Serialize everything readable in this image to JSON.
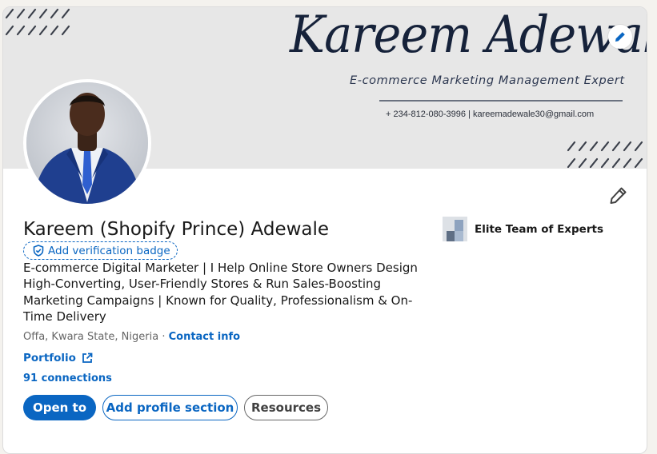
{
  "banner": {
    "name": "Kareem Adewale",
    "subtitle": "E-commerce Marketing Management Expert",
    "contact": "+ 234-812-080-3996  |  kareemadewale30@gmail.com"
  },
  "profile": {
    "name": "Kareem (Shopify Prince) Adewale",
    "verification_label": "Add verification badge",
    "headline": "E-commerce Digital Marketer | I Help Online Store Owners Design High-Converting, User-Friendly Stores & Run Sales-Boosting Marketing Campaigns | Known for Quality, Professionalism & On-Time Delivery",
    "location": "Offa, Kwara State, Nigeria",
    "separator": "·",
    "contact_info": "Contact info",
    "portfolio": "Portfolio",
    "connections": "91 connections"
  },
  "company": {
    "name": "Elite Team of Experts"
  },
  "actions": {
    "open_to": "Open to",
    "add_section": "Add profile section",
    "resources": "Resources"
  },
  "icons": {
    "edit_banner": "pencil-icon",
    "edit_profile": "pencil-icon",
    "verification": "shield-check-icon",
    "portfolio_link": "external-link-icon"
  },
  "colors": {
    "accent": "#0a66c2",
    "banner_bg": "#e7e7e7",
    "banner_text": "#16223a"
  }
}
